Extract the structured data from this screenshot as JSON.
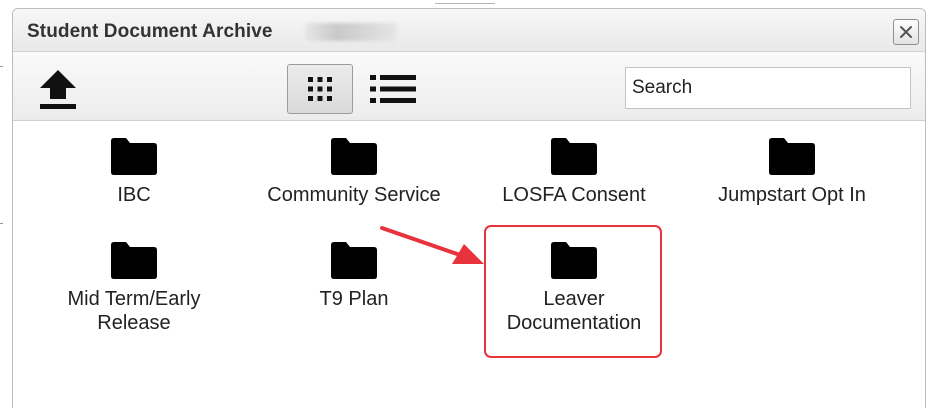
{
  "window": {
    "title": "Student Document Archive"
  },
  "toolbar": {
    "upload_icon": "upload-arrow-icon",
    "grid_icon": "grid-view-icon",
    "list_icon": "list-view-icon",
    "search_placeholder": "Search"
  },
  "folders": [
    {
      "label": "IBC",
      "icon": "folder-icon"
    },
    {
      "label": "Community Service",
      "icon": "folder-icon"
    },
    {
      "label": "LOSFA Consent",
      "icon": "folder-icon"
    },
    {
      "label": "Jumpstart Opt In",
      "icon": "folder-icon"
    },
    {
      "label": "Mid Term/Early Release",
      "icon": "folder-icon"
    },
    {
      "label": "T9 Plan",
      "icon": "folder-icon"
    },
    {
      "label": "Leaver Documentation",
      "icon": "folder-icon"
    }
  ],
  "annotation": {
    "highlight_color": "#e8323c",
    "arrow_icon": "red-arrow-annotation"
  }
}
